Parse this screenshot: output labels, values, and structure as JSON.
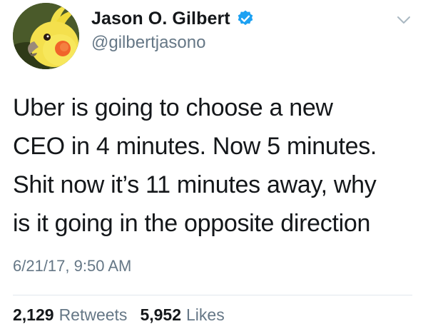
{
  "user": {
    "display_name": "Jason O. Gilbert",
    "handle": "@gilbertjasono",
    "verified": true,
    "avatar_icon": "cockatiel-avatar"
  },
  "tweet": {
    "text": "Uber is going to choose a new\nCEO in 4 minutes. Now 5 minutes.\nShit now it’s 11 minutes away, why\nis it going in the opposite direction",
    "timestamp": "6/21/17, 9:50 AM"
  },
  "stats": {
    "retweets_count": "2,129",
    "retweets_label": "Retweets",
    "likes_count": "5,952",
    "likes_label": "Likes"
  },
  "colors": {
    "text": "#14171a",
    "secondary": "#657786",
    "verified_blue": "#1da1f2",
    "divider": "#e1e8ed"
  }
}
